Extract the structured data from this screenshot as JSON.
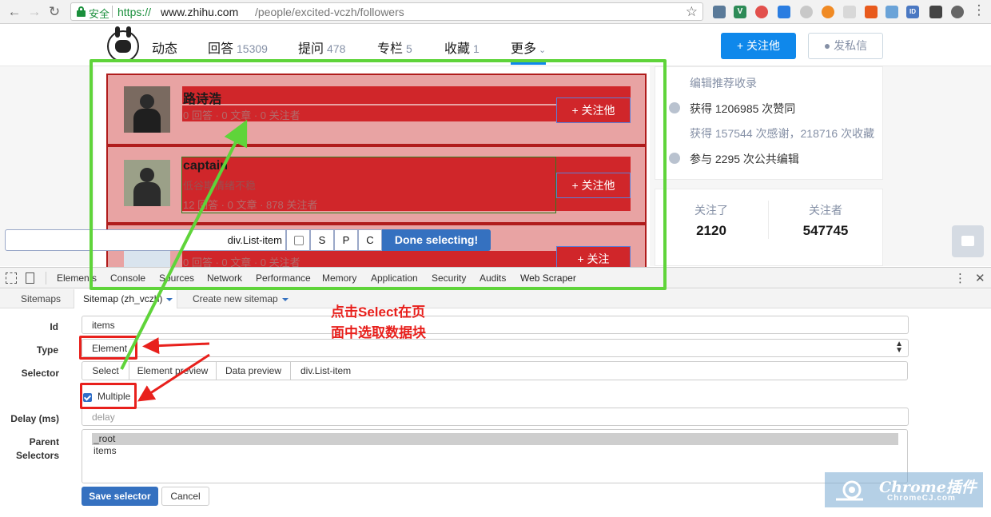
{
  "browser": {
    "secure_label": "安全",
    "url_scheme": "https://",
    "url_host": "www.zhihu.com",
    "url_path": "/people/excited-vczh/followers"
  },
  "zhihu": {
    "tabs": [
      {
        "label": "动态",
        "count": ""
      },
      {
        "label": "回答",
        "count": "15309"
      },
      {
        "label": "提问",
        "count": "478"
      },
      {
        "label": "专栏",
        "count": "5"
      },
      {
        "label": "收藏",
        "count": "1"
      },
      {
        "label": "更多",
        "count": ""
      }
    ],
    "follow_button": "关注他",
    "message_button": "发私信",
    "followers": [
      {
        "name": "路诗浩",
        "bio": "",
        "meta": "0 回答 · 0 文章 · 0 关注者",
        "follow": "关注他"
      },
      {
        "name": "captain",
        "bio": "低谷期情绪不稳",
        "meta": "12 回答 · 0 文章 · 878 关注者",
        "follow": "关注他"
      },
      {
        "name": "",
        "bio": "",
        "meta": "0 回答 · 0 文章 · 0 关注者",
        "follow": "关注"
      }
    ],
    "sidebar": {
      "edit_recommend": "编辑推荐收录",
      "likes": "获得 1206985 次赞同",
      "thanks": "获得 157544 次感谢，218716 次收藏",
      "edits": "参与 2295 次公共编辑",
      "following_label": "关注了",
      "following_value": "2120",
      "followers_label": "关注者",
      "followers_value": "547745"
    }
  },
  "selection_bar": {
    "selector": "div.List-item",
    "keys": [
      "S",
      "P",
      "C"
    ],
    "done": "Done selecting!"
  },
  "devtools": {
    "tabs": [
      "Elements",
      "Console",
      "Sources",
      "Network",
      "Performance",
      "Memory",
      "Application",
      "Security",
      "Audits",
      "Web Scraper"
    ],
    "active_tab": "Web Scraper"
  },
  "webscraper": {
    "nav": [
      "Sitemaps",
      "Sitemap (zh_vczh)",
      "Create new sitemap"
    ],
    "form": {
      "id_label": "Id",
      "id_value": "items",
      "type_label": "Type",
      "type_value": "Element",
      "selector_label": "Selector",
      "select_btn": "Select",
      "element_preview_btn": "Element preview",
      "data_preview_btn": "Data preview",
      "selector_value": "div.List-item",
      "multiple_label": "Multiple",
      "delay_label": "Delay (ms)",
      "delay_placeholder": "delay",
      "parent_label_1": "Parent",
      "parent_label_2": "Selectors",
      "parent_options": [
        "_root",
        "items"
      ],
      "save": "Save selector",
      "cancel": "Cancel"
    }
  },
  "annotation": {
    "line1": "点击Select在页",
    "line2": "面中选取数据块"
  },
  "watermark": {
    "title": "Chrome插件",
    "sub": "ChromeCJ.com"
  },
  "colors": {
    "zhihu_blue": "#0f88eb",
    "scraper_blue": "#3571c0",
    "annotation_red": "#e8201c",
    "annotation_green": "#5fd43a",
    "selection_red": "#d0262a"
  }
}
